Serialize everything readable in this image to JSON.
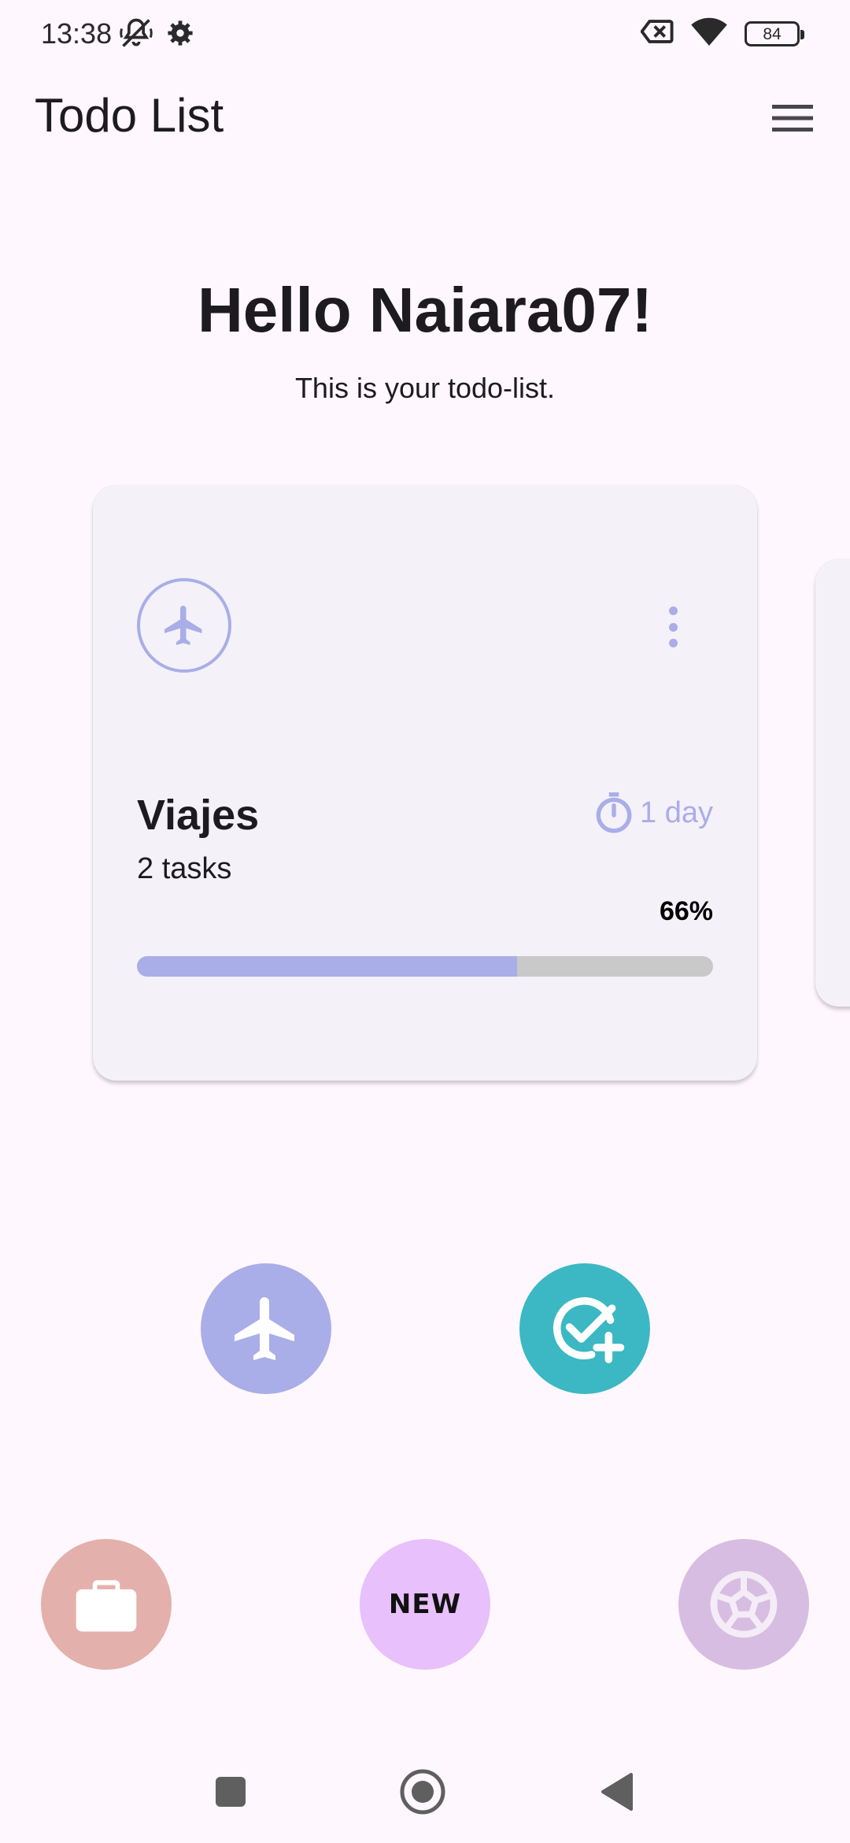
{
  "status_bar": {
    "time": "13:38",
    "battery": "84",
    "icons": [
      "mute-icon",
      "settings-icon",
      "sim-off-icon",
      "wifi-icon",
      "battery-icon"
    ]
  },
  "app_bar": {
    "title": "Todo List",
    "menu_icon": "hamburger-menu-icon"
  },
  "greeting": {
    "title": "Hello Naiara07!",
    "subtitle": "This is your todo-list."
  },
  "card": {
    "icon": "airplane-icon",
    "title": "Viajes",
    "tasks": "2 tasks",
    "time_label": "1 day",
    "time_icon": "timer-icon",
    "percent_label": "66%",
    "progress": 0.66,
    "accent_color": "#a9aee8"
  },
  "action_buttons": [
    {
      "name": "airplane-category",
      "icon": "airplane-icon",
      "color": "#a9aee8"
    },
    {
      "name": "add-task",
      "icon": "check-add-icon",
      "color": "#3bb8c3"
    }
  ],
  "category_buttons": [
    {
      "name": "work",
      "icon": "briefcase-icon",
      "color": "#e4b0ab"
    },
    {
      "name": "new",
      "label": "NEW",
      "color": "#e8c0fb"
    },
    {
      "name": "sport",
      "icon": "soccer-ball-icon",
      "color": "#d8bde2"
    }
  ],
  "nav_bar": {
    "icons": [
      "recents-square-icon",
      "home-circle-icon",
      "back-triangle-icon"
    ]
  }
}
